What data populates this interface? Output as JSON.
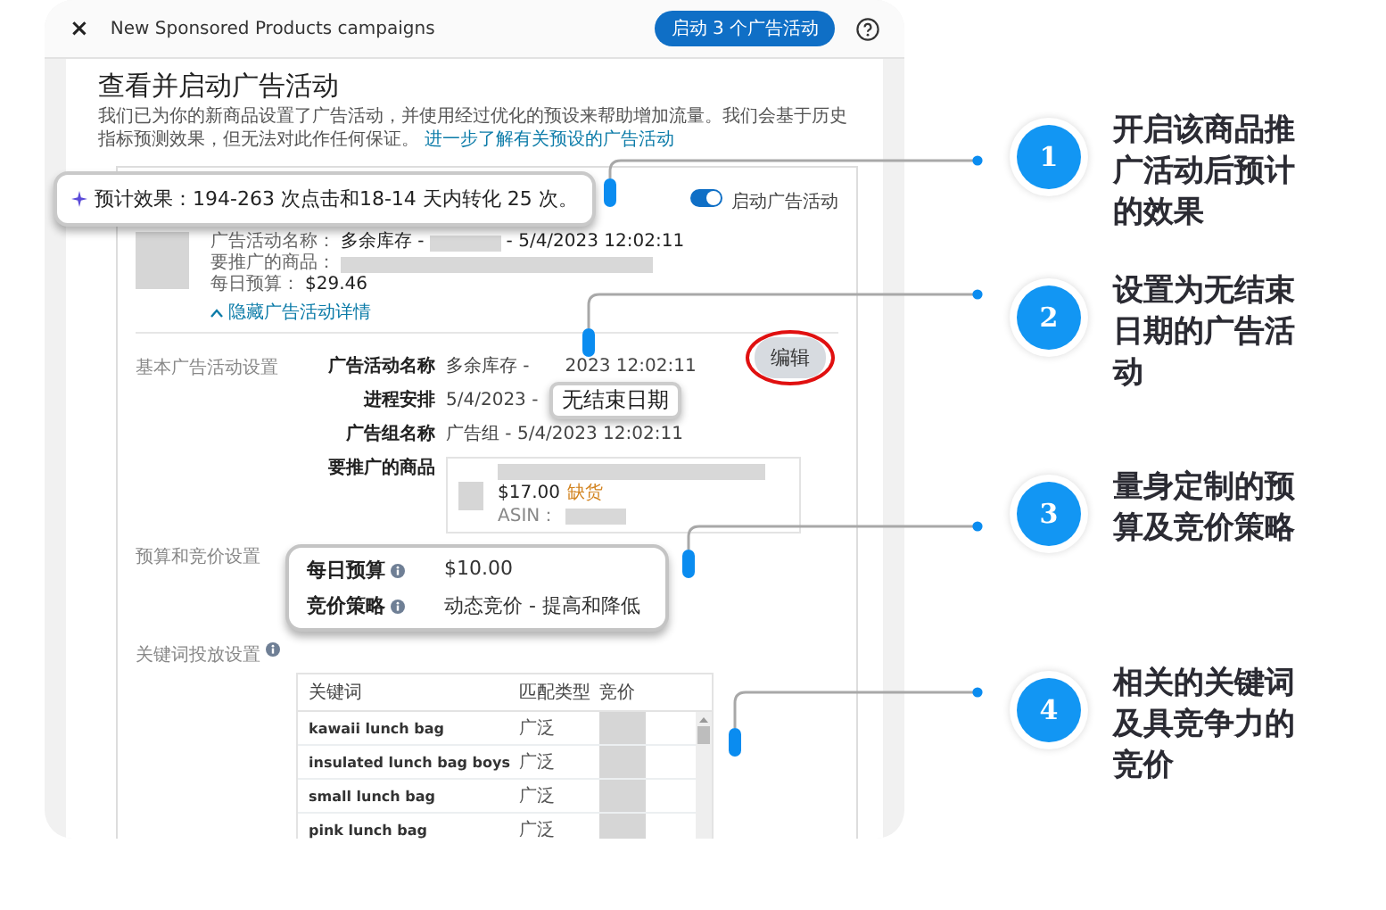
{
  "header": {
    "close": "×",
    "title": "New Sponsored Products campaigns",
    "launch_button": "启动 3 个广告活动"
  },
  "page": {
    "title": "查看并启动广告活动",
    "description": "我们已为你的新商品设置了广告活动，并使用经过优化的预设来帮助增加流量。我们会基于历史指标预测效果，但无法对此作任何保证。",
    "learn_more_link": "进一步了解有关预设的广告活动"
  },
  "estimate_callout": "预计效果：194-263 次点击和18-14 天内转化 25 次。",
  "campaign_card": {
    "toggle": {
      "label": "启动广告活动",
      "on": true
    },
    "name_label": "广告活动名称：",
    "name_prefix": "多余库存 -",
    "name_suffix": "- 5/4/2023 12:02:11",
    "product_label": "要推广的商品：",
    "budget_label": "每日预算：",
    "budget_value": "$29.46",
    "hide_details_link": "隐藏广告活动详情"
  },
  "basic_settings": {
    "section_label": "基本广告活动设置",
    "edit_button": "编辑",
    "end_date_callout": "无结束日期",
    "rows": [
      {
        "kind": "text",
        "label": "广告活动名称",
        "value": "多余库存 -",
        "value_end": "2023 12:02:11"
      },
      {
        "kind": "text",
        "label": "进程安排",
        "value": "5/4/2023 -"
      },
      {
        "kind": "text",
        "label": "广告组名称",
        "value": "广告组 - 5/4/2023 12:02:11"
      },
      {
        "kind": "product",
        "label": "要推广的商品"
      }
    ],
    "product": {
      "price": "$17.00",
      "stock_status": "缺货",
      "asin_label": "ASIN："
    }
  },
  "budget_settings": {
    "section_label": "预算和竞价设置",
    "rows": [
      {
        "label": "每日预算",
        "value": "$10.00"
      },
      {
        "label": "竞价策略",
        "value": "动态竞价 - 提高和降低"
      }
    ]
  },
  "keyword_settings": {
    "section_label": "关键词投放设置",
    "table": {
      "columns": [
        "关键词",
        "匹配类型",
        "竞价"
      ],
      "rows": [
        {
          "keyword": "kawaii lunch bag",
          "match_type": "广泛"
        },
        {
          "keyword": "insulated lunch bag boys",
          "match_type": "广泛"
        },
        {
          "keyword": "small lunch bag",
          "match_type": "广泛"
        },
        {
          "keyword": "pink lunch bag",
          "match_type": "广泛"
        }
      ]
    }
  },
  "annotations": [
    {
      "number": "1",
      "text": "开启该商品推广活动后预计的效果"
    },
    {
      "number": "2",
      "text": "设置为无结束日期的广告活动"
    },
    {
      "number": "3",
      "text": "量身定制的预算及竞价策略"
    },
    {
      "number": "4",
      "text": "相关的关键词及具竞争力的竞价"
    }
  ]
}
